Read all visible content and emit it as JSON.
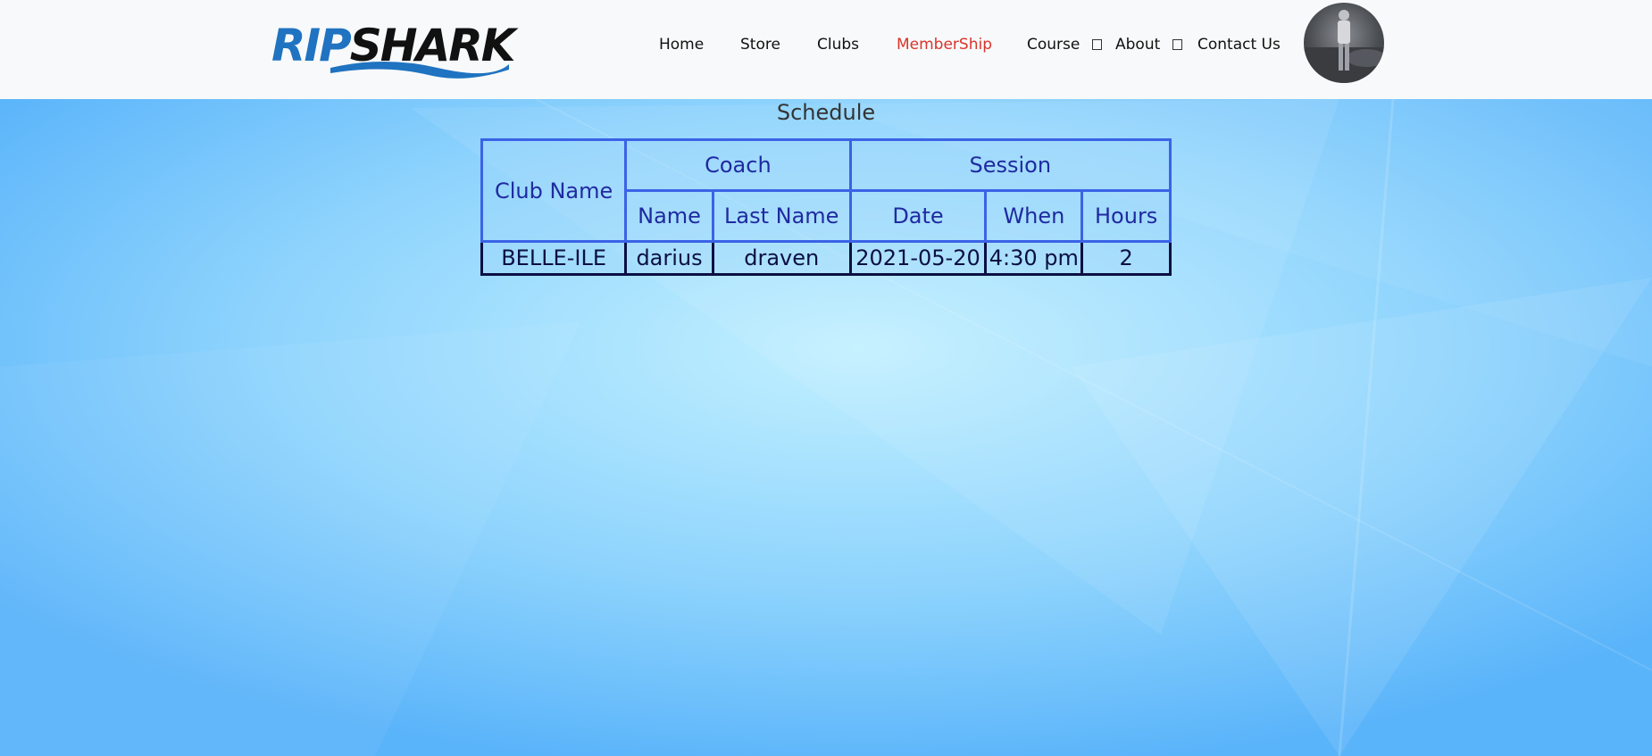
{
  "header": {
    "logo": {
      "part1": "RIP",
      "part2": "SHARK"
    },
    "nav": {
      "home": "Home",
      "store": "Store",
      "clubs": "Clubs",
      "membership": "MemberShip",
      "course": "Course",
      "about": "About",
      "contact": "Contact Us"
    },
    "active_item": "MemberShip",
    "active_color": "#d9342b"
  },
  "page": {
    "title": "Schedule"
  },
  "table": {
    "headers": {
      "club_name": "Club Name",
      "coach": "Coach",
      "session": "Session",
      "name": "Name",
      "last_name": "Last Name",
      "date": "Date",
      "when": "When",
      "hours": "Hours"
    },
    "rows": [
      {
        "club_name": "BELLE-ILE",
        "name": "darius",
        "last_name": "draven",
        "date": "2021-05-20",
        "when": "4:30 pm",
        "hours": "2"
      }
    ]
  },
  "colors": {
    "header_bg": "#f8f9fa",
    "page_bg": "#6ec3fb",
    "table_header_border": "#3a63e6",
    "table_row_border": "#0b0f45",
    "logo_blue": "#1f73c1"
  }
}
